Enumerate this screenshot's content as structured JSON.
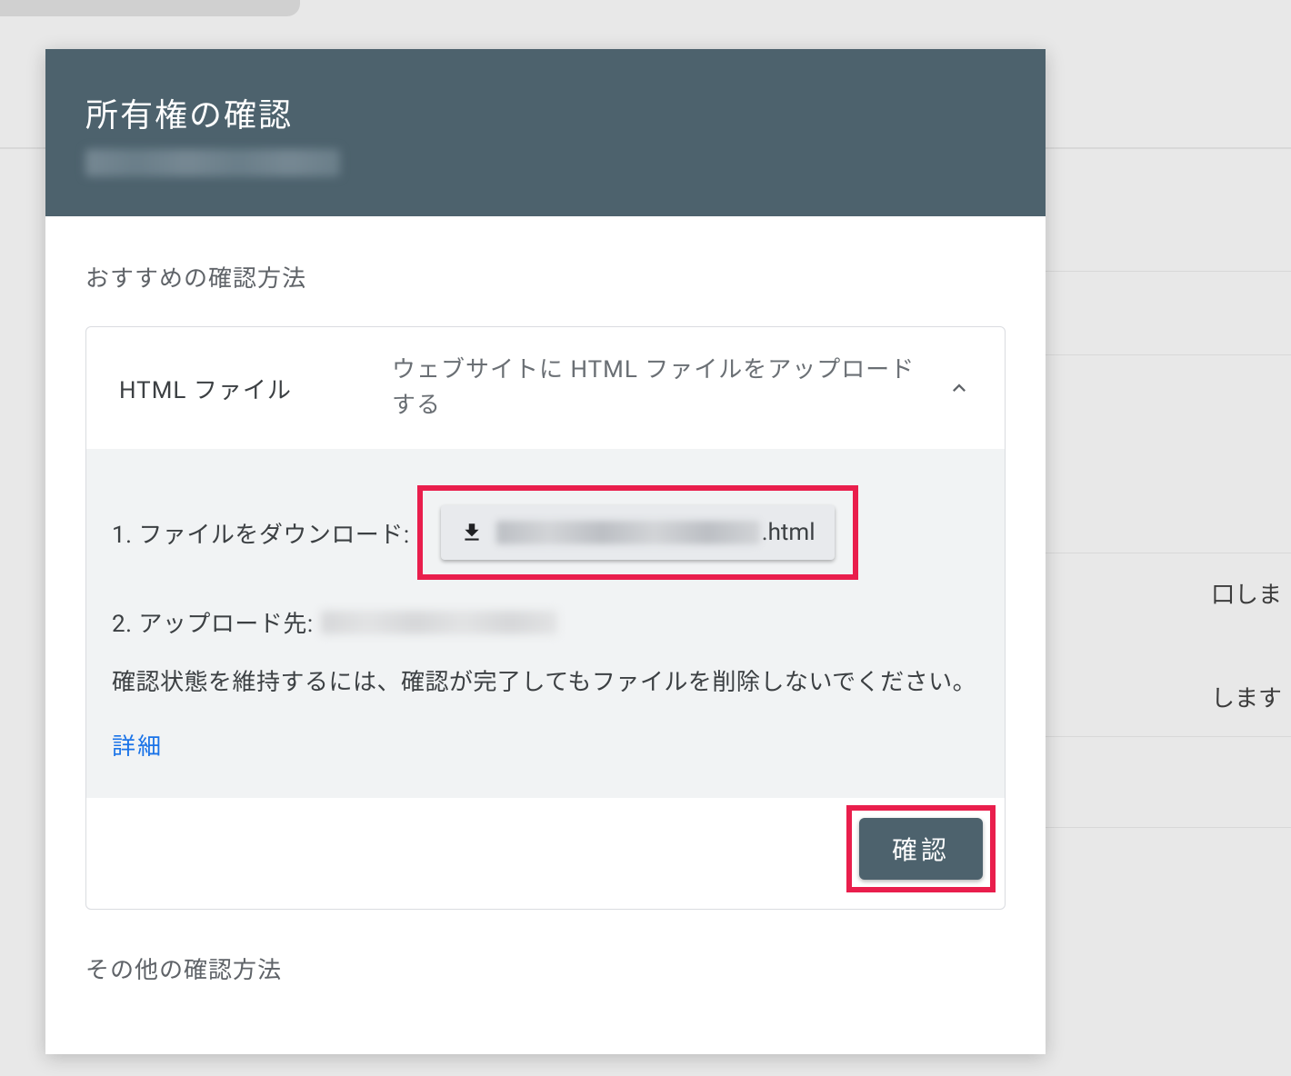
{
  "background": {
    "text1": "口しま",
    "text2": "します"
  },
  "dialog": {
    "title": "所有権の確認",
    "recommended_section_title": "おすすめの確認方法",
    "other_section_title": "その他の確認方法",
    "card": {
      "method_name": "HTML ファイル",
      "method_description": "ウェブサイトに HTML ファイルをアップロードする",
      "step1_label": "1. ファイルをダウンロード:",
      "download_ext": ".html",
      "step2_label": "2. アップロード先:",
      "note": "確認状態を維持するには、確認が完了してもファイルを削除しないでください。",
      "details_link": "詳細",
      "confirm_button": "確認"
    }
  }
}
